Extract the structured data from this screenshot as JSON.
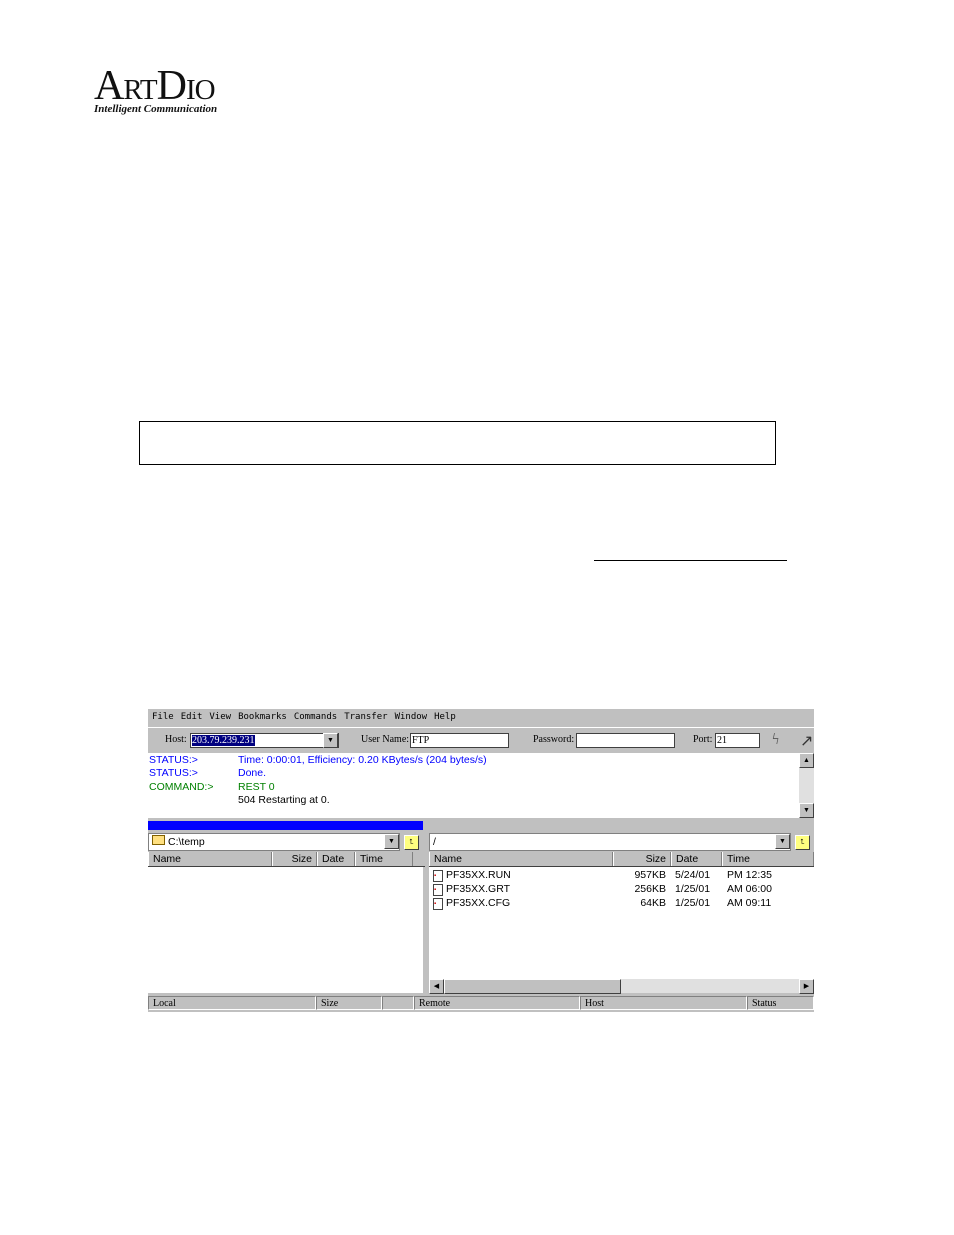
{
  "logo": {
    "name": "ArtDio",
    "tagline": "Intelligent Communication"
  },
  "app": {
    "menu": [
      "File",
      "Edit",
      "View",
      "Bookmarks",
      "Commands",
      "Transfer",
      "Window",
      "Help"
    ],
    "toolbar": {
      "host_label": "Host:",
      "host_value": "203.79.239.231",
      "user_label": "User Name:",
      "user_value": "FTP",
      "password_label": "Password:",
      "password_value": "",
      "port_label": "Port:",
      "port_value": "21"
    },
    "log": [
      {
        "tag": "STATUS:>",
        "msg": "Time: 0:00:01, Efficiency: 0.20 KBytes/s (204 bytes/s)",
        "color": "#0000ff"
      },
      {
        "tag": "STATUS:>",
        "msg": "Done.",
        "color": "#0000ff"
      },
      {
        "tag": "COMMAND:>",
        "msg": "REST 0",
        "color": "#008000"
      },
      {
        "tag": "",
        "msg": "504 Restarting at 0.",
        "color": "#000000"
      }
    ],
    "local": {
      "path": "C:\\temp",
      "columns": [
        "Name",
        "Size",
        "Date",
        "Time"
      ]
    },
    "remote": {
      "path": "/",
      "columns": [
        "Name",
        "Size",
        "Date",
        "Time"
      ],
      "files": [
        {
          "name": "PF35XX.RUN",
          "size": "957KB",
          "date": "5/24/01",
          "time": "PM 12:35"
        },
        {
          "name": "PF35XX.GRT",
          "size": "256KB",
          "date": "1/25/01",
          "time": "AM 06:00"
        },
        {
          "name": "PF35XX.CFG",
          "size": "64KB",
          "date": "1/25/01",
          "time": "AM 09:11"
        }
      ]
    },
    "statusbar": [
      "Local",
      "Size",
      "",
      "Remote",
      "Host",
      "Status"
    ]
  }
}
